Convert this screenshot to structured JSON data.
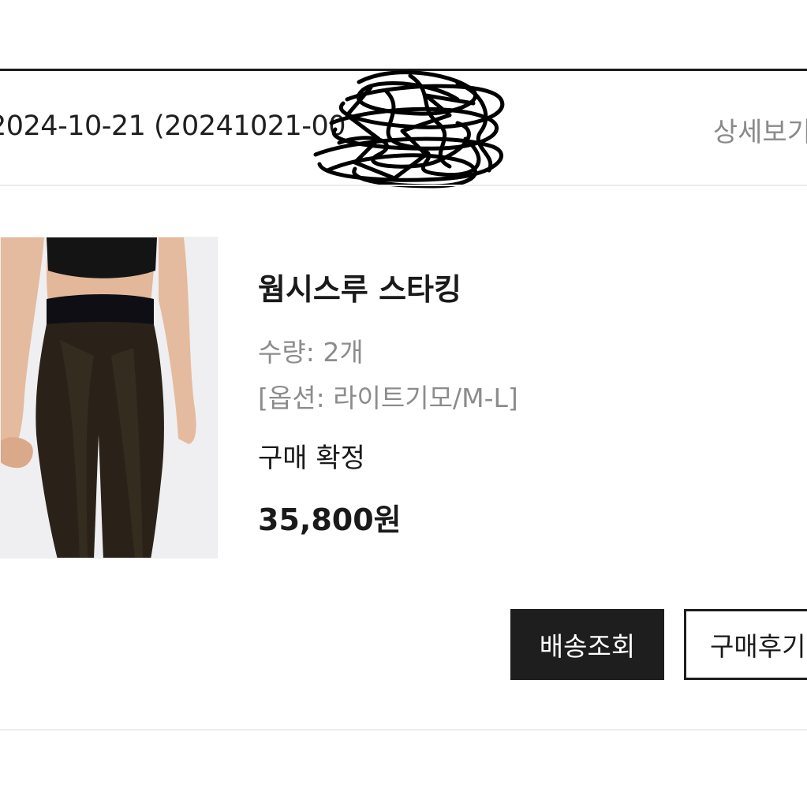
{
  "order": {
    "date_line": "2024-10-21 (20241021-00",
    "details_link": "상세보기"
  },
  "product": {
    "image_alt": "웜시스루 스타킹 상품 이미지",
    "name": "웜시스루 스타킹",
    "quantity": "수량: 2개",
    "option": "[옵션: 라이트기모/M-L]",
    "status": "구매 확정",
    "price": "35,800원"
  },
  "actions": {
    "track_label": "배송조회",
    "review_label": "구매후기"
  },
  "colors": {
    "primary_button": "#1e1e1e",
    "muted_text": "#8c8c8c",
    "divider": "#ececec"
  }
}
